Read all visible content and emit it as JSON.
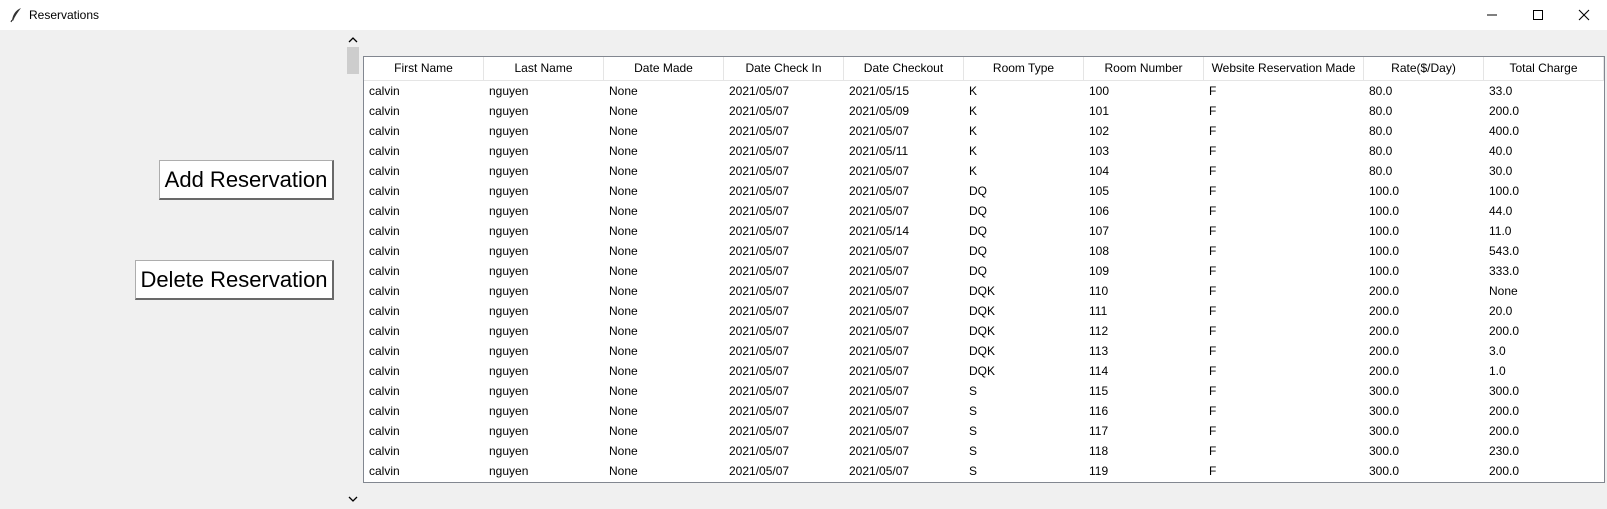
{
  "window": {
    "title": "Reservations",
    "icon": "feather-icon",
    "controls": [
      "minimize-icon",
      "maximize-icon",
      "close-icon"
    ]
  },
  "buttons": {
    "add_label": "Add Reservation",
    "delete_label": "Delete Reservation"
  },
  "table": {
    "columns": [
      "First Name",
      "Last Name",
      "Date Made",
      "Date Check In",
      "Date Checkout",
      "Room Type",
      "Room Number",
      "Website Reservation Made",
      "Rate($/Day)",
      "Total Charge"
    ],
    "rows": [
      [
        "calvin",
        "nguyen",
        "None",
        "2021/05/07",
        "2021/05/15",
        "K",
        "100",
        "F",
        "80.0",
        "33.0"
      ],
      [
        "calvin",
        "nguyen",
        "None",
        "2021/05/07",
        "2021/05/09",
        "K",
        "101",
        "F",
        "80.0",
        "200.0"
      ],
      [
        "calvin",
        "nguyen",
        "None",
        "2021/05/07",
        "2021/05/07",
        "K",
        "102",
        "F",
        "80.0",
        "400.0"
      ],
      [
        "calvin",
        "nguyen",
        "None",
        "2021/05/07",
        "2021/05/11",
        "K",
        "103",
        "F",
        "80.0",
        "40.0"
      ],
      [
        "calvin",
        "nguyen",
        "None",
        "2021/05/07",
        "2021/05/07",
        "K",
        "104",
        "F",
        "80.0",
        "30.0"
      ],
      [
        "calvin",
        "nguyen",
        "None",
        "2021/05/07",
        "2021/05/07",
        "DQ",
        "105",
        "F",
        "100.0",
        "100.0"
      ],
      [
        "calvin",
        "nguyen",
        "None",
        "2021/05/07",
        "2021/05/07",
        "DQ",
        "106",
        "F",
        "100.0",
        "44.0"
      ],
      [
        "calvin",
        "nguyen",
        "None",
        "2021/05/07",
        "2021/05/14",
        "DQ",
        "107",
        "F",
        "100.0",
        "11.0"
      ],
      [
        "calvin",
        "nguyen",
        "None",
        "2021/05/07",
        "2021/05/07",
        "DQ",
        "108",
        "F",
        "100.0",
        "543.0"
      ],
      [
        "calvin",
        "nguyen",
        "None",
        "2021/05/07",
        "2021/05/07",
        "DQ",
        "109",
        "F",
        "100.0",
        "333.0"
      ],
      [
        "calvin",
        "nguyen",
        "None",
        "2021/05/07",
        "2021/05/07",
        "DQK",
        "110",
        "F",
        "200.0",
        "None"
      ],
      [
        "calvin",
        "nguyen",
        "None",
        "2021/05/07",
        "2021/05/07",
        "DQK",
        "111",
        "F",
        "200.0",
        "20.0"
      ],
      [
        "calvin",
        "nguyen",
        "None",
        "2021/05/07",
        "2021/05/07",
        "DQK",
        "112",
        "F",
        "200.0",
        "200.0"
      ],
      [
        "calvin",
        "nguyen",
        "None",
        "2021/05/07",
        "2021/05/07",
        "DQK",
        "113",
        "F",
        "200.0",
        "3.0"
      ],
      [
        "calvin",
        "nguyen",
        "None",
        "2021/05/07",
        "2021/05/07",
        "DQK",
        "114",
        "F",
        "200.0",
        "1.0"
      ],
      [
        "calvin",
        "nguyen",
        "None",
        "2021/05/07",
        "2021/05/07",
        "S",
        "115",
        "F",
        "300.0",
        "300.0"
      ],
      [
        "calvin",
        "nguyen",
        "None",
        "2021/05/07",
        "2021/05/07",
        "S",
        "116",
        "F",
        "300.0",
        "200.0"
      ],
      [
        "calvin",
        "nguyen",
        "None",
        "2021/05/07",
        "2021/05/07",
        "S",
        "117",
        "F",
        "300.0",
        "200.0"
      ],
      [
        "calvin",
        "nguyen",
        "None",
        "2021/05/07",
        "2021/05/07",
        "S",
        "118",
        "F",
        "300.0",
        "230.0"
      ],
      [
        "calvin",
        "nguyen",
        "None",
        "2021/05/07",
        "2021/05/07",
        "S",
        "119",
        "F",
        "300.0",
        "200.0"
      ]
    ]
  },
  "scrollbar": {
    "up_icon": "chevron-up-icon",
    "down_icon": "chevron-down-icon"
  }
}
